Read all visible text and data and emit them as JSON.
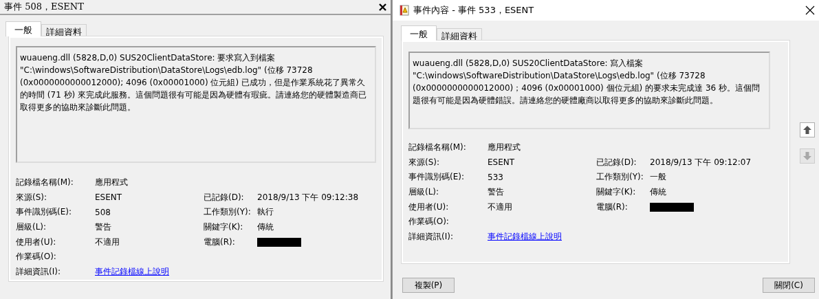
{
  "dialogs": [
    {
      "kind": "legacy",
      "title": "事件 508，ESENT",
      "tabs": [
        {
          "label": "一般",
          "selected": true
        },
        {
          "label": "詳細資料",
          "selected": false
        }
      ],
      "message": "wuaueng.dll (5828,D,0) SUS20ClientDataStore: 要求寫入到檔案 \"C:\\windows\\SoftwareDistribution\\DataStore\\Logs\\edb.log\" (位移 73728 (0x0000000000012000); 4096 (0x00001000) 位元組) 已成功，但是作業系統花了異常久的時間 (71 秒) 來完成此服務。這個問題很有可能是因為硬體有瑕疵。請連絡您的硬體製造商已取得更多的協助來診斷此問題。",
      "rows": [
        {
          "left": {
            "label": "記錄檔名稱(M):",
            "value": "應用程式"
          }
        },
        {
          "left": {
            "label": "來源(S):",
            "value": "ESENT"
          },
          "right": {
            "label": "已記錄(D):",
            "value": "2018/9/13 下午 09:12:38"
          }
        },
        {
          "left": {
            "label": "事件識別碼(E):",
            "value": "508"
          },
          "right": {
            "label": "工作類別(Y):",
            "value": "執行"
          }
        },
        {
          "left": {
            "label": "層級(L):",
            "value": "警告"
          },
          "right": {
            "label": "關鍵字(K):",
            "value": "傳統"
          }
        },
        {
          "left": {
            "label": "使用者(U):",
            "value": "不適用"
          },
          "right": {
            "label": "電腦(R):",
            "kind": "redacted"
          }
        },
        {
          "left": {
            "label": "作業碼(O):"
          }
        },
        {
          "left": {
            "label": "詳細資訊(I):",
            "value": "事件記錄檔線上說明",
            "kind": "link"
          }
        }
      ]
    },
    {
      "kind": "modern",
      "title": "事件內容 - 事件 533，ESENT",
      "tabs": [
        {
          "label": "一般",
          "selected": true
        },
        {
          "label": "詳細資料",
          "selected": false
        }
      ],
      "message": "wuaueng.dll (5828,D,0) SUS20ClientDataStore: 寫入檔案 \"C:\\windows\\SoftwareDistribution\\DataStore\\Logs\\edb.log\" (位移 73728 (0x0000000000012000)；4096 (0x00001000) 個位元組) 的要求未完成達 36 秒。這個問題很有可能是因為硬體錯誤。請連絡您的硬體廠商以取得更多的協助來診斷此問題。",
      "rows": [
        {
          "left": {
            "label": "記錄檔名稱(M):",
            "value": "應用程式"
          }
        },
        {
          "left": {
            "label": "來源(S):",
            "value": "ESENT"
          },
          "right": {
            "label": "已記錄(D):",
            "value": "2018/9/13 下午 09:12:07"
          }
        },
        {
          "left": {
            "label": "事件識別碼(E):",
            "value": "533"
          },
          "right": {
            "label": "工作類別(Y):",
            "value": "一般"
          }
        },
        {
          "left": {
            "label": "層級(L):",
            "value": "警告"
          },
          "right": {
            "label": "關鍵字(K):",
            "value": "傳統"
          }
        },
        {
          "left": {
            "label": "使用者(U):",
            "value": "不適用"
          },
          "right": {
            "label": "電腦(R):",
            "kind": "redacted"
          }
        },
        {
          "left": {
            "label": "作業碼(O):"
          }
        },
        {
          "left": {
            "label": "詳細資訊(I):",
            "value": "事件記錄檔線上說明",
            "kind": "link"
          }
        }
      ],
      "nav": [
        {
          "kind": "up",
          "disabled": false
        },
        {
          "kind": "down",
          "disabled": true
        }
      ],
      "buttons": [
        {
          "label": "複製(P)"
        },
        {
          "label": "關閉(C)"
        }
      ]
    }
  ]
}
